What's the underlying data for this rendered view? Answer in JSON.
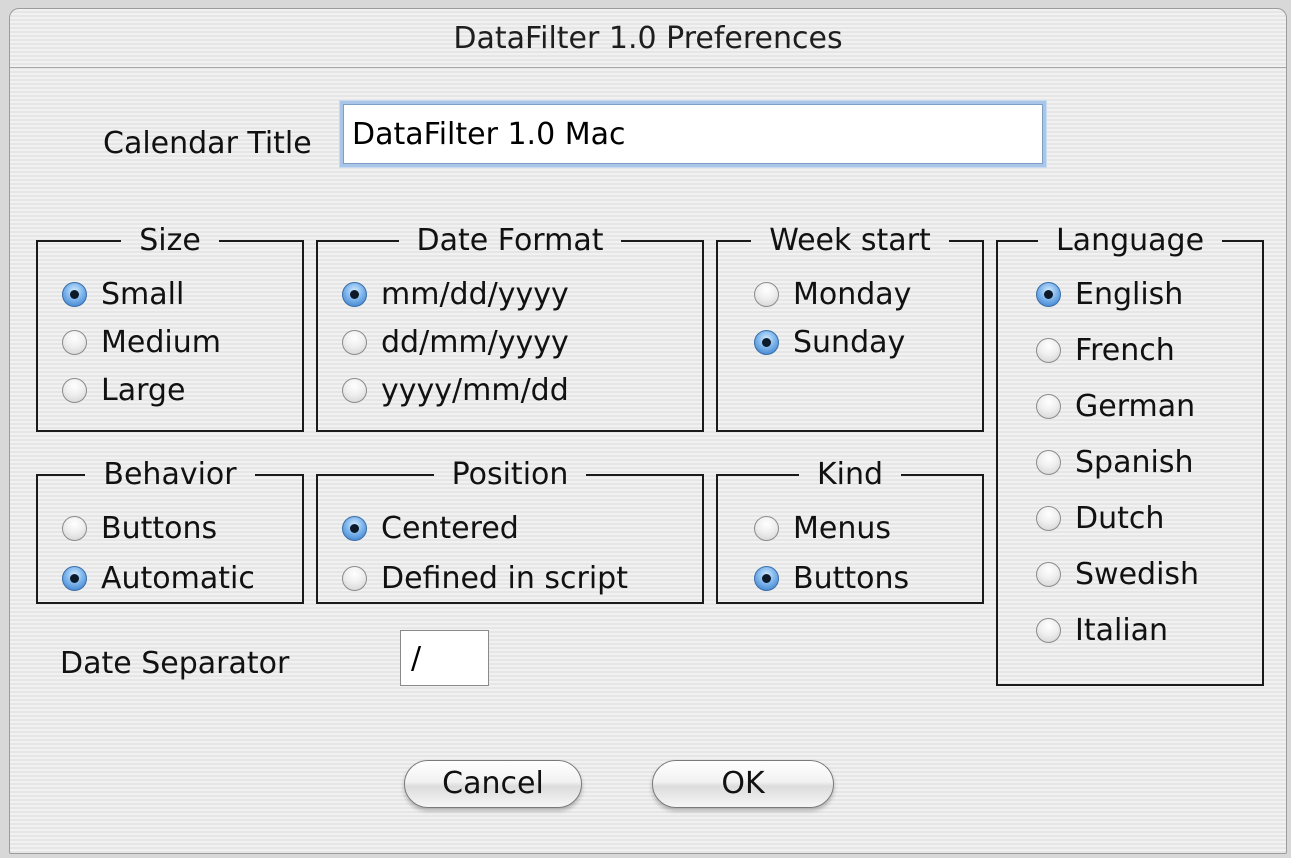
{
  "window": {
    "title": "DataFilter 1.0 Preferences"
  },
  "calendar_title": {
    "label": "Calendar Title",
    "value": "DataFilter 1.0 Mac"
  },
  "size": {
    "legend": "Size",
    "options": [
      "Small",
      "Medium",
      "Large"
    ],
    "selected": "Small"
  },
  "date_format": {
    "legend": "Date Format",
    "options": [
      "mm/dd/yyyy",
      "dd/mm/yyyy",
      "yyyy/mm/dd"
    ],
    "selected": "mm/dd/yyyy"
  },
  "week_start": {
    "legend": "Week start",
    "options": [
      "Monday",
      "Sunday"
    ],
    "selected": "Sunday"
  },
  "language": {
    "legend": "Language",
    "options": [
      "English",
      "French",
      "German",
      "Spanish",
      "Dutch",
      "Swedish",
      "Italian"
    ],
    "selected": "English"
  },
  "behavior": {
    "legend": "Behavior",
    "options": [
      "Buttons",
      "Automatic"
    ],
    "selected": "Automatic"
  },
  "position": {
    "legend": "Position",
    "options": [
      "Centered",
      "Defined in script"
    ],
    "selected": "Centered"
  },
  "kind": {
    "legend": "Kind",
    "options": [
      "Menus",
      "Buttons"
    ],
    "selected": "Buttons"
  },
  "date_separator": {
    "label": "Date Separator",
    "value": "/"
  },
  "buttons": {
    "cancel": "Cancel",
    "ok": "OK"
  },
  "colors": {
    "radio_selected": "#2f74c7",
    "focus_ring": "#a9c6e8"
  }
}
